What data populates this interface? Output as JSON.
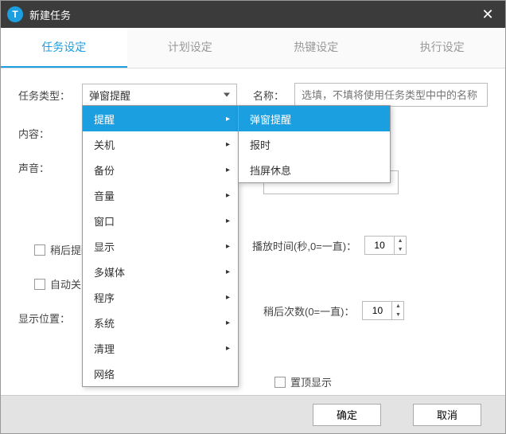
{
  "window": {
    "title": "新建任务",
    "icon_letter": "T"
  },
  "tabs": [
    {
      "label": "任务设定",
      "active": true
    },
    {
      "label": "计划设定",
      "active": false
    },
    {
      "label": "热键设定",
      "active": false
    },
    {
      "label": "执行设定",
      "active": false
    }
  ],
  "form": {
    "task_type_label": "任务类型：",
    "task_type_value": "弹窗提醒",
    "name_label": "名称：",
    "name_placeholder": "选填，不填将使用任务类型中中的名称",
    "content_label": "内容：",
    "sound_label": "声音：",
    "playtime_label": "播放时间(秒,0=一直)：",
    "playtime_value": "10",
    "later_remind_label": "稍后提醒",
    "later_count_label": "稍后次数(0=一直)：",
    "later_count_value": "10",
    "auto_close_label": "自动关闭",
    "position_label": "显示位置：",
    "topmost_label": "置顶显示"
  },
  "dropdown": {
    "items": [
      {
        "label": "提醒",
        "has_sub": true,
        "selected": true
      },
      {
        "label": "关机",
        "has_sub": true
      },
      {
        "label": "备份",
        "has_sub": true
      },
      {
        "label": "音量",
        "has_sub": true
      },
      {
        "label": "窗口",
        "has_sub": true
      },
      {
        "label": "显示",
        "has_sub": true
      },
      {
        "label": "多媒体",
        "has_sub": true
      },
      {
        "label": "程序",
        "has_sub": true
      },
      {
        "label": "系统",
        "has_sub": true
      },
      {
        "label": "清理",
        "has_sub": true
      },
      {
        "label": "网络"
      }
    ],
    "submenu": [
      {
        "label": "弹窗提醒",
        "selected": true
      },
      {
        "label": "报时"
      },
      {
        "label": "挡屏休息"
      }
    ]
  },
  "buttons": {
    "ok": "确定",
    "cancel": "取消"
  }
}
